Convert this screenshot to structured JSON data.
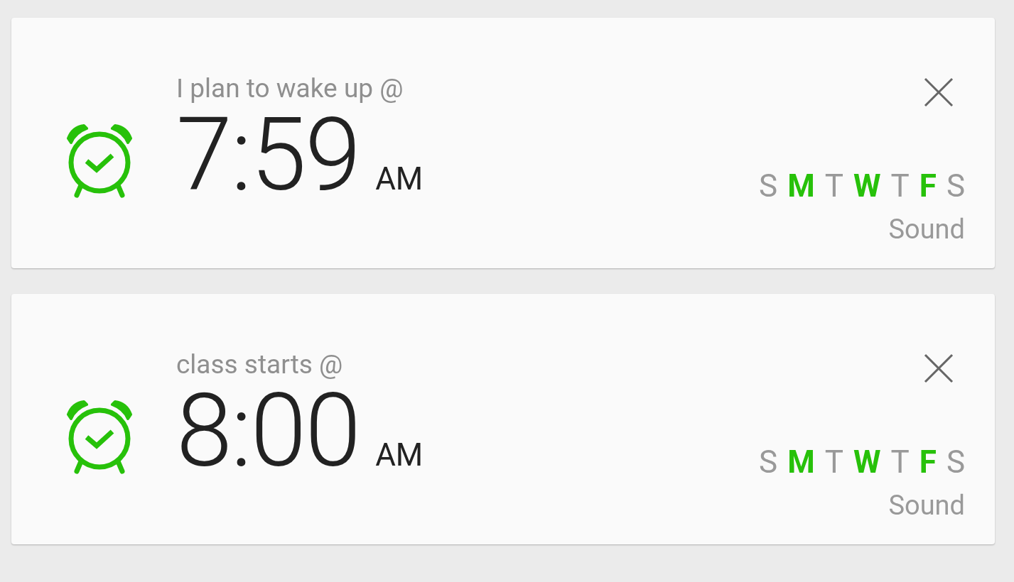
{
  "alarms": [
    {
      "label": "I plan to wake up @",
      "time": "7:59",
      "meridiem": "AM",
      "enabled": true,
      "sound": "Sound",
      "days": [
        {
          "letter": "S",
          "on": false
        },
        {
          "letter": "M",
          "on": true
        },
        {
          "letter": "T",
          "on": false
        },
        {
          "letter": "W",
          "on": true
        },
        {
          "letter": "T",
          "on": false
        },
        {
          "letter": "F",
          "on": true
        },
        {
          "letter": "S",
          "on": false
        }
      ]
    },
    {
      "label": "class starts @",
      "time": "8:00",
      "meridiem": "AM",
      "enabled": true,
      "sound": "Sound",
      "days": [
        {
          "letter": "S",
          "on": false
        },
        {
          "letter": "M",
          "on": true
        },
        {
          "letter": "T",
          "on": false
        },
        {
          "letter": "W",
          "on": true
        },
        {
          "letter": "T",
          "on": false
        },
        {
          "letter": "F",
          "on": true
        },
        {
          "letter": "S",
          "on": false
        }
      ]
    }
  ]
}
